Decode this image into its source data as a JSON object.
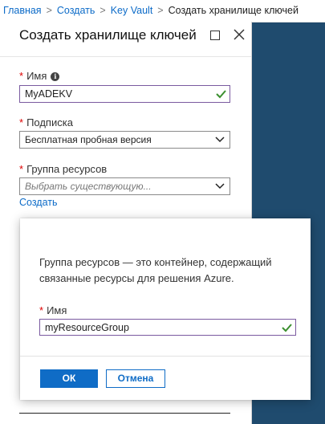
{
  "breadcrumb": {
    "items": [
      "Главная",
      "Создать",
      "Key Vault"
    ],
    "current": "Создать хранилище ключей",
    "separator": ">"
  },
  "blade": {
    "title": "Создать хранилище ключей",
    "maximize_icon": "maximize-icon",
    "close_icon": "close-icon"
  },
  "form": {
    "name": {
      "label": "Имя",
      "value": "MyADEKV",
      "required_mark": "*",
      "valid": true
    },
    "subscription": {
      "label": "Подписка",
      "value": "Бесплатная пробная версия",
      "required_mark": "*"
    },
    "resource_group": {
      "label": "Группа ресурсов",
      "placeholder": "Выбрать существующую...",
      "required_mark": "*"
    },
    "create_link": "Создать"
  },
  "dialog": {
    "description": "Группа ресурсов — это контейнер, содержащий связанные ресурсы для решения Azure.",
    "name_label": "Имя",
    "name_required_mark": "*",
    "name_value": "myResourceGroup",
    "ok_label": "ОК",
    "cancel_label": "Отмена"
  },
  "colors": {
    "link": "#0c6bc8",
    "primary_button": "#0f6cc6",
    "valid_check": "#3b8f2f",
    "required": "#d00000",
    "background_strip": "#1f4b6e",
    "valid_border": "#7a5aa0"
  }
}
